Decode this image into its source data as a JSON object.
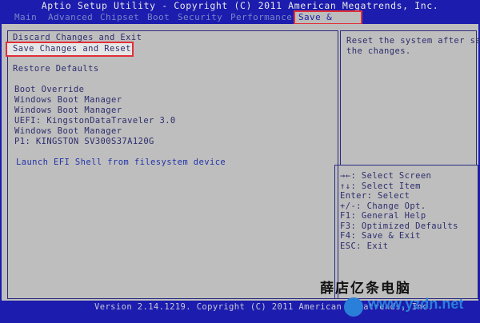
{
  "window": {
    "title": "Aptio Setup Utility - Copyright (C) 2011 American Megatrends, Inc."
  },
  "menu": {
    "items": [
      {
        "label": "Main"
      },
      {
        "label": "Advanced"
      },
      {
        "label": "Chipset"
      },
      {
        "label": "Boot"
      },
      {
        "label": "Security"
      },
      {
        "label": "Performance"
      },
      {
        "label": "Save & Exit"
      }
    ],
    "active": "Save & Exit"
  },
  "main": {
    "options": [
      {
        "label": "Discard Changes and Exit"
      },
      {
        "label": "Save Changes and Reset"
      },
      {
        "label": "Restore Defaults"
      },
      {
        "label": "Boot Override"
      },
      {
        "label": "Windows Boot Manager"
      },
      {
        "label": "Windows Boot Manager"
      },
      {
        "label": "UEFI: KingstonDataTraveler 3.0"
      },
      {
        "label": "Windows Boot Manager"
      },
      {
        "label": "P1: KINGSTON SV300S37A120G"
      },
      {
        "label": "Launch EFI Shell from filesystem device"
      }
    ],
    "selected": "Save Changes and Reset"
  },
  "help": {
    "line1": "Reset the system after sa",
    "line2": "the changes."
  },
  "keys": [
    {
      "label": "→←: Select Screen"
    },
    {
      "label": "↑↓: Select Item"
    },
    {
      "label": "Enter: Select"
    },
    {
      "label": "+/-: Change Opt."
    },
    {
      "label": "F1: General Help"
    },
    {
      "label": "F3: Optimized Defaults"
    },
    {
      "label": "F4: Save & Exit"
    },
    {
      "label": "ESC: Exit"
    }
  ],
  "footer": {
    "text": "Version 2.14.1219. Copyright (C) 2011 American Megatrends, Inc."
  },
  "watermark": {
    "title": "薛店亿条电脑",
    "url": "www.yzdn.net"
  },
  "colors": {
    "bios_blue": "#1c1cae",
    "panel_gray": "#bebebe",
    "highlight_red": "#e0303a"
  }
}
